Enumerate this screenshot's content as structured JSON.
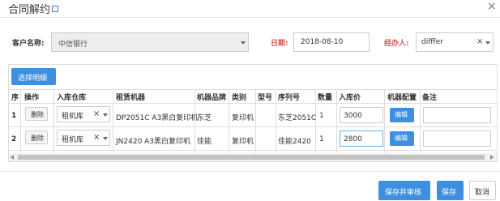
{
  "dialog": {
    "title": "合同解约",
    "close_symbol": "×"
  },
  "form": {
    "customer_label": "客户名称:",
    "customer_value": "中信银行",
    "date_label": "日期:",
    "date_value": "2018-08-10",
    "handler_label": "经办人:",
    "handler_value": "difffer",
    "clear_symbol": "×"
  },
  "detail": {
    "choose_label": "选择明细",
    "headers": [
      "序",
      "操作",
      "入库仓库",
      "租赁机器",
      "机器品牌",
      "类别",
      "型号",
      "序列号",
      "数量",
      "入库价",
      "机器配置",
      "备注"
    ],
    "rows": [
      {
        "index": "1",
        "delete_label": "删除",
        "warehouse": "租机库",
        "machine": "DP2051C A3黑白复印机",
        "brand": "东芝",
        "category": "复印机",
        "model": "",
        "serial": "东芝2051C",
        "quantity": "1",
        "price": "3000",
        "edit_label": "编辑",
        "remark": ""
      },
      {
        "index": "2",
        "delete_label": "删除",
        "warehouse": "租机库",
        "machine": "JN2420 A3黑白复印机",
        "brand": "佳能",
        "category": "复印机",
        "model": "",
        "serial": "佳能2420",
        "quantity": "1",
        "price": "2800",
        "edit_label": "编辑",
        "remark": ""
      }
    ]
  },
  "footer": {
    "save_review_label": "保存并审核",
    "save_label": "保存",
    "cancel_label": "取消"
  },
  "colors": {
    "primary": "#3e8fe0",
    "required_label": "#d9534f"
  }
}
